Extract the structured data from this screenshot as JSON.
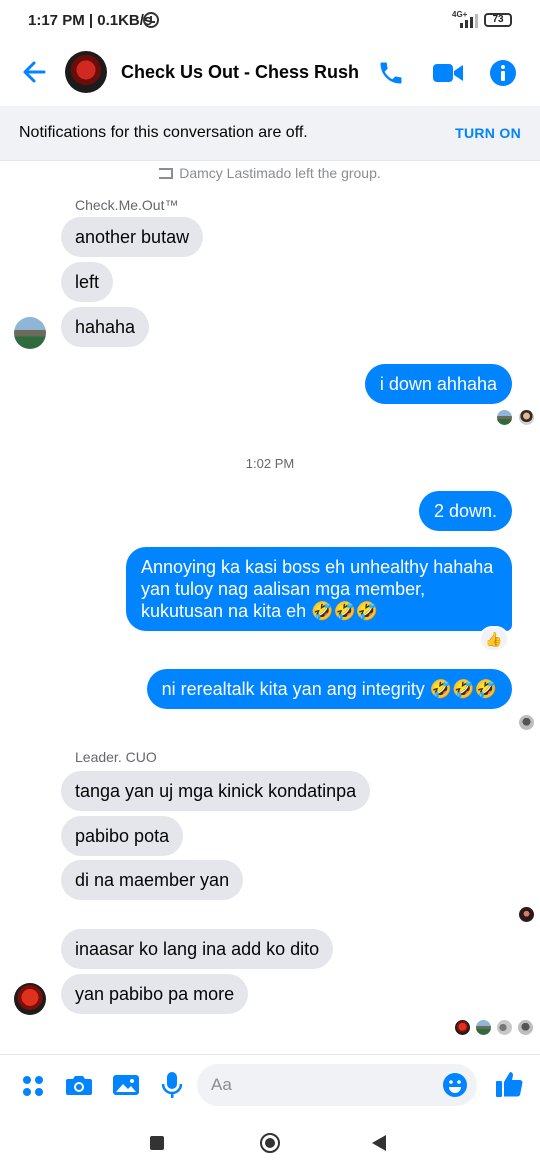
{
  "status_bar": {
    "time": "1:17 PM | 0.1KB/s",
    "network": "4G+",
    "battery": "73"
  },
  "header": {
    "title": "Check Us Out - Chess Rush"
  },
  "notification": {
    "text": "Notifications for this conversation are off.",
    "action": "TURN ON"
  },
  "messages": {
    "system_left": "Damcy Lastimado left the group.",
    "sender1": "Check.Me.Out™",
    "in1": "another butaw",
    "in2": "left",
    "in3": "hahaha",
    "out1": "i down ahhaha",
    "time1": "1:02 PM",
    "out2": "2 down.",
    "out3": "Annoying ka kasi boss eh unhealthy hahaha yan tuloy nag aalisan mga member, kukutusan na kita eh 🤣🤣🤣",
    "reaction": "👍",
    "out4": "ni rerealtalk kita yan ang integrity 🤣🤣🤣",
    "sender2": "Leader. CUO",
    "in4": "tanga yan uj mga kinick kondatinpa",
    "in5": "pabibo pota",
    "in6": "di na maember yan",
    "in7": "inaasar ko lang ina add ko dito",
    "in8": "yan pabibo pa more"
  },
  "composer": {
    "placeholder": "Aa"
  },
  "colors": {
    "accent": "#0084ff",
    "bubble_incoming": "#e4e6eb",
    "banner": "#f0f2f5"
  },
  "icons": [
    "back-arrow-icon",
    "phone-icon",
    "video-camera-icon",
    "info-icon",
    "apps-icon",
    "camera-icon",
    "gallery-icon",
    "microphone-icon",
    "emoji-icon",
    "thumbs-up-icon"
  ]
}
